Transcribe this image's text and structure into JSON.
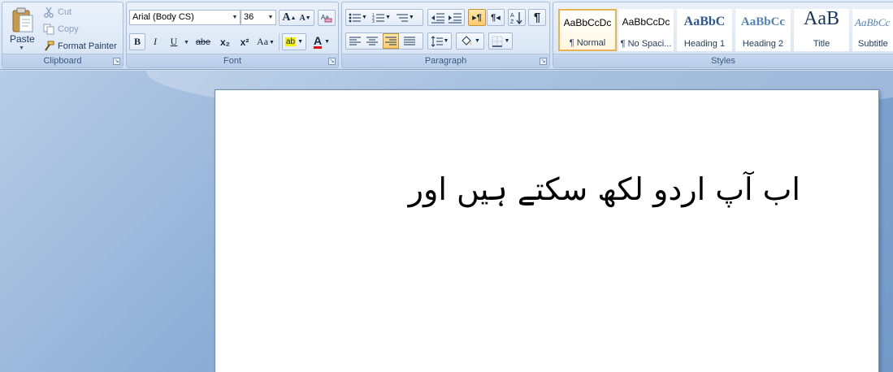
{
  "clipboard": {
    "group_label": "Clipboard",
    "paste_label": "Paste",
    "cut_label": "Cut",
    "copy_label": "Copy",
    "format_painter_label": "Format Painter"
  },
  "font": {
    "group_label": "Font",
    "font_name": "Arial (Body CS)",
    "font_size": "36",
    "grow_label": "A",
    "shrink_label": "A",
    "bold_label": "B",
    "italic_label": "I",
    "underline_label": "U",
    "strike_label": "abe",
    "subscript_label": "x₂",
    "superscript_label": "x²",
    "case_label": "Aa",
    "highlight_label": "ab",
    "font_color_label": "A",
    "font_color": "#e01010"
  },
  "paragraph": {
    "group_label": "Paragraph",
    "show_marks_label": "¶"
  },
  "styles": {
    "group_label": "Styles",
    "items": [
      {
        "preview": "AaBbCcDc",
        "name": "¶ Normal"
      },
      {
        "preview": "AaBbCcDc",
        "name": "¶ No Spaci..."
      },
      {
        "preview": "AaBbC",
        "name": "Heading 1"
      },
      {
        "preview": "AaBbCc",
        "name": "Heading 2"
      },
      {
        "preview": "AaB",
        "name": "Title"
      },
      {
        "preview": "AaBbCc",
        "name": "Subtitle"
      }
    ]
  },
  "document": {
    "text": "اب آپ اردو لکھ سکتے ہیں اور"
  },
  "colors": {
    "accent_selected": "#e8b452",
    "heading_blue": "#2b5797"
  }
}
